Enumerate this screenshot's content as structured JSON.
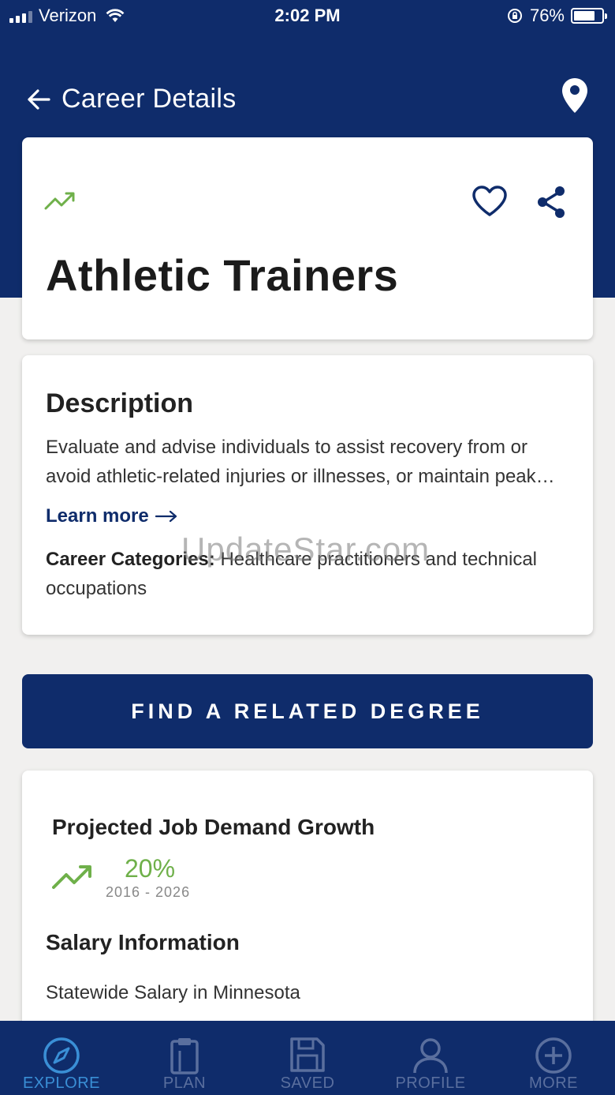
{
  "status_bar": {
    "carrier": "Verizon",
    "time": "2:02 PM",
    "battery": "76%",
    "battery_level": 0.76
  },
  "header": {
    "title": "Career Details"
  },
  "career": {
    "title": "Athletic Trainers"
  },
  "description": {
    "heading": "Description",
    "text": "Evaluate and advise individuals to assist recovery from or avoid athletic-related injuries or illnesses, or maintain peak…",
    "learn_more": "Learn more",
    "categories_label": "Career Categories:",
    "categories_value": "Healthcare practitioners and technical occupations"
  },
  "watermark": "UpdateStar.com",
  "cta": {
    "label": "FIND A RELATED DEGREE"
  },
  "stats": {
    "growth_heading": "Projected Job Demand Growth",
    "growth_value": "20%",
    "growth_range": "2016 - 2026",
    "salary_heading": "Salary Information",
    "salary_sub": "Statewide Salary in Minnesota"
  },
  "tabs": [
    {
      "label": "EXPLORE",
      "icon": "compass-icon",
      "active": true
    },
    {
      "label": "PLAN",
      "icon": "clipboard-icon",
      "active": false
    },
    {
      "label": "SAVED",
      "icon": "floppy-icon",
      "active": false
    },
    {
      "label": "PROFILE",
      "icon": "person-icon",
      "active": false
    },
    {
      "label": "MORE",
      "icon": "plus-circle-icon",
      "active": false
    }
  ],
  "colors": {
    "brand": "#0f2c6b",
    "accent_green": "#6fb04a",
    "active_tab": "#3a8fd6",
    "inactive_tab": "#5a6f9e"
  }
}
